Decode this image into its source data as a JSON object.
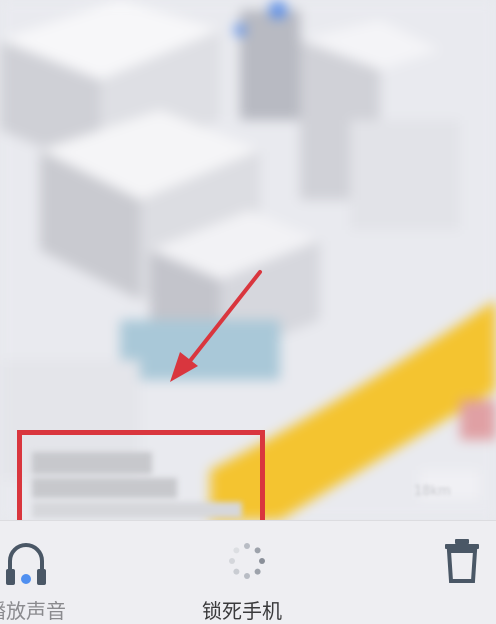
{
  "toolbar": {
    "play_sound_label": "播放声音",
    "lock_phone_label": "锁死手机"
  },
  "map": {
    "distance_readout": "18km"
  },
  "colors": {
    "highlight": "#d9363e",
    "road": "#f4c430",
    "trash_icon": "#4a5766"
  },
  "icons": {
    "sound": "headphones-icon",
    "lock": "loading-spinner-icon",
    "erase": "trash-icon"
  }
}
